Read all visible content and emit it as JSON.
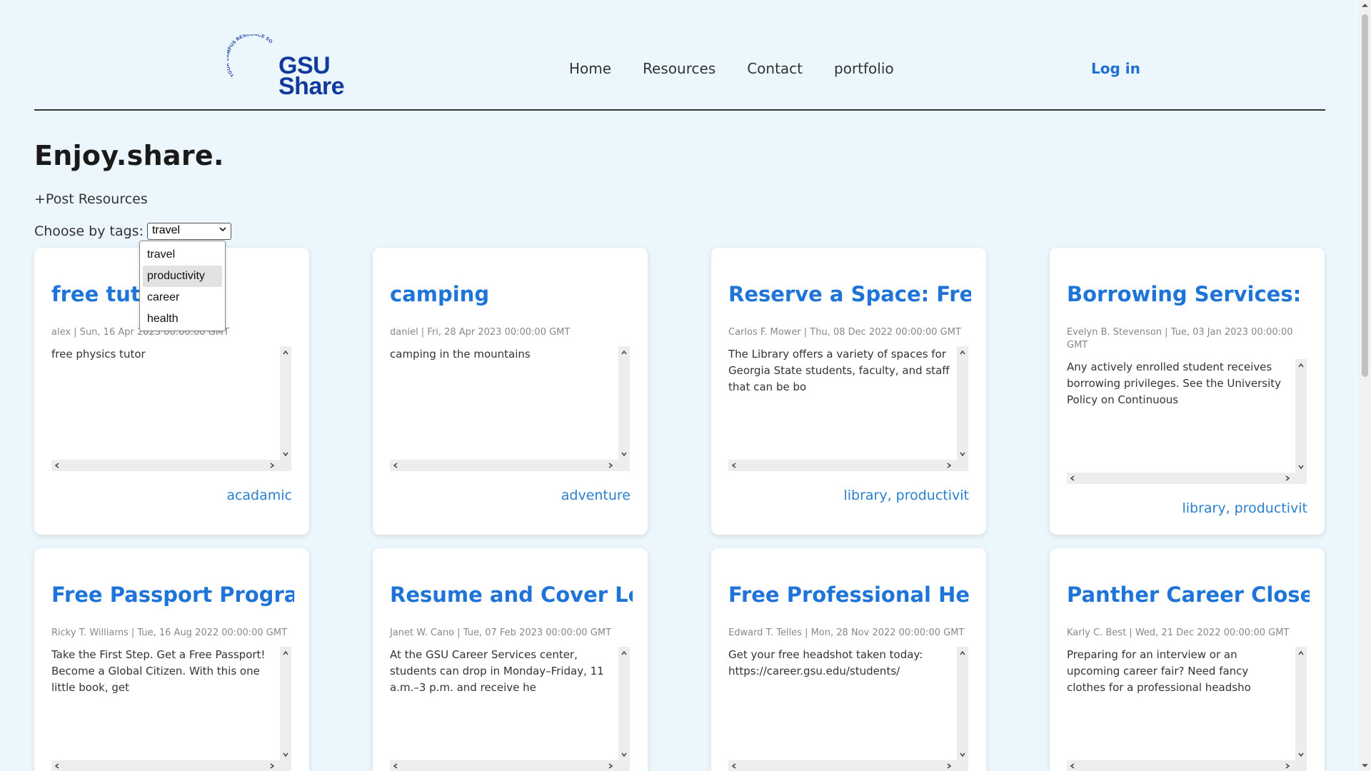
{
  "header": {
    "logo_arc_text": "YOUR CAMPUS RESOURCE SOLUTION",
    "logo_line1": "GSU",
    "logo_line2": "Share",
    "nav": [
      "Home",
      "Resources",
      "Contact",
      "portfolio"
    ],
    "login": "Log in"
  },
  "hero": {
    "title": "Enjoy.share.",
    "post_link": "+Post Resources",
    "tags_label": "Choose by tags:",
    "selected_tag": "travel",
    "options": [
      "travel",
      "productivity",
      "career",
      "health"
    ],
    "highlighted_option": "productivity"
  },
  "cards": [
    {
      "title": "free tuto",
      "meta": "alex | Sun, 16 Apr 2023 00:00:00 GMT",
      "body": "free physics tutor",
      "tags": "acadamic"
    },
    {
      "title": "camping",
      "meta": "daniel | Fri, 28 Apr 2023 00:00:00 GMT",
      "body": "camping in the mountains",
      "tags": "adventure"
    },
    {
      "title": "Reserve a Space: Fre",
      "meta": "Carlos F. Mower | Thu, 08 Dec 2022 00:00:00 GMT",
      "body": "The Library offers a variety of spaces for Georgia State students, faculty, and staff that can be bo",
      "tags": "library, productivit"
    },
    {
      "title": "Borrowing Services:",
      "meta": "Evelyn B. Stevenson | Tue, 03 Jan 2023 00:00:00 GMT",
      "body": "Any actively enrolled student receives borrowing privileges. See the University Policy on Continuous",
      "tags": "library, productivit"
    },
    {
      "title": "Free Passport Progra",
      "meta": "Ricky T. Williams | Tue, 16 Aug 2022 00:00:00 GMT",
      "body": "Take the First Step. Get a Free Passport! Become a Global Citizen. With this one little book, get",
      "tags": ""
    },
    {
      "title": "Resume and Cover Let",
      "meta": "Janet W. Cano | Tue, 07 Feb 2023 00:00:00 GMT",
      "body": "At the GSU Career Services center, students can drop in Monday–Friday, 11 a.m.–3 p.m. and receive he",
      "tags": ""
    },
    {
      "title": "Free Professional He",
      "meta": "Edward T. Telles | Mon, 28 Nov 2022 00:00:00 GMT",
      "body": "Get your free headshot taken today: https://career.gsu.edu/students/",
      "tags": ""
    },
    {
      "title": "Panther Career Close",
      "meta": "Karly C. Best | Wed, 21 Dec 2022 00:00:00 GMT",
      "body": "Preparing for an interview or an upcoming career fair? Need fancy clothes for a professional headsho",
      "tags": ""
    }
  ],
  "colors": {
    "background": "#ecf7fd",
    "accent": "#1f74d8",
    "logo": "#123a9c"
  }
}
